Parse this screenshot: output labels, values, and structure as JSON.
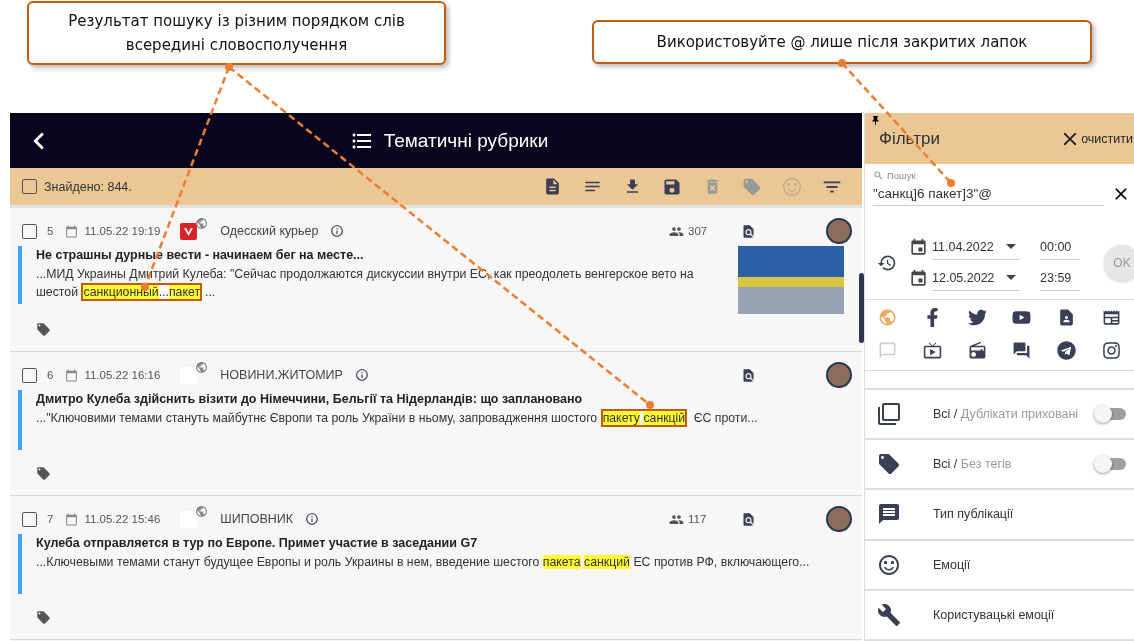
{
  "callouts": [
    {
      "text": "Результат пошуку із різним порядком слів всередині словосполучення"
    },
    {
      "text": "Використовуйте  @ лише після закритих лапок"
    }
  ],
  "header": {
    "title": "Тематичні рубрики"
  },
  "toolbar": {
    "checked": false,
    "found": "Знайдено: 844."
  },
  "items": [
    {
      "checked": false,
      "number": "5",
      "date": "11.05.22 19:19",
      "brand_logo": true,
      "source": "Одесский курьер",
      "audience": "307",
      "thumbnail": true,
      "title": "Не страшны дурные вести - начинаем бег на месте...",
      "snippet": [
        {
          "kind": "text",
          "text": "...МИД Украины Дмитрий Кулеба: \"Сейчас продолжаются дискуссии внутри ЕС, как преодолеть венгерское вето на шестой "
        },
        {
          "kind": "frame",
          "parts": [
            {
              "kind": "text",
              "text": "санкционный",
              "highlight": true
            },
            {
              "kind": "text",
              "text": "...",
              "highlight": false
            },
            {
              "kind": "text",
              "text": "пакет",
              "highlight": true
            }
          ]
        },
        {
          "kind": "text",
          "text": "..."
        }
      ]
    },
    {
      "checked": false,
      "number": "6",
      "date": "11.05.22 16:16",
      "brand_logo": false,
      "source": "НОВИНИ.ЖИТОМИР",
      "thumbnail": false,
      "title": "Дмитро Кулеба здійснить візити до Німеччини, Бельгії та Нідерландів: що заплановано",
      "snippet": [
        {
          "kind": "text",
          "text": "...\"Ключовими темами стануть майбутнє Європи та роль України в ньому, запровадження шостого "
        },
        {
          "kind": "frame",
          "parts": [
            {
              "kind": "text",
              "text": "пакету",
              "highlight": true
            },
            {
              "kind": "gap"
            },
            {
              "kind": "text",
              "text": "санкцій",
              "highlight": true
            }
          ]
        },
        {
          "kind": "text",
          "text": " ЄС проти..."
        }
      ]
    },
    {
      "checked": false,
      "number": "7",
      "date": "11.05.22 15:46",
      "brand_logo": false,
      "source": "ШИПОВНИК",
      "audience": "117",
      "thumbnail": false,
      "title": "Кулеба отправляется в тур по Европе. Примет участие в заседании G7",
      "snippet": [
        {
          "kind": "text",
          "text": "...Ключевыми темами станут будущее Европы и роль Украины в нем, введение шестого "
        },
        {
          "kind": "text",
          "text": "пакета",
          "highlight": true
        },
        {
          "kind": "gap"
        },
        {
          "kind": "text",
          "text": "санкций",
          "highlight": true
        },
        {
          "kind": "text",
          "text": " ЕС против РФ, включающего...",
          "highlight": false
        }
      ]
    }
  ],
  "filters": {
    "title": "Фільтри",
    "clear": "очистити",
    "search_label": "Пошук",
    "search_value": "\"санкц]6 пакет]3\"@",
    "dates": [
      {
        "date": "11.04.2022",
        "time": "00:00"
      },
      {
        "date": "12.05.2022",
        "time": "23:59"
      }
    ],
    "ok": "OK",
    "sources": [
      {
        "kind": "web",
        "selected": true
      },
      {
        "kind": "facebook",
        "selected": false
      },
      {
        "kind": "twitter",
        "selected": false
      },
      {
        "kind": "youtube",
        "selected": false
      },
      {
        "kind": "contact",
        "selected": false
      },
      {
        "kind": "news",
        "selected": false
      },
      {
        "kind": "comment",
        "selected": false,
        "disabled": true
      },
      {
        "kind": "tv",
        "selected": false
      },
      {
        "kind": "radio",
        "selected": false
      },
      {
        "kind": "forum",
        "selected": false
      },
      {
        "kind": "telegram",
        "selected": false
      },
      {
        "kind": "instagram",
        "selected": false
      }
    ],
    "rows": [
      {
        "kind": "duplicates",
        "all": "Всі /",
        "option": "Дублікати приховані",
        "on": false
      },
      {
        "kind": "tags",
        "all": "Всі /",
        "option": "Без тегів",
        "on": false
      },
      {
        "kind": "types",
        "label": "Тип публікації"
      },
      {
        "kind": "emotions",
        "label": "Емоції"
      },
      {
        "kind": "custom",
        "label": "Користувацькі емоції"
      }
    ]
  }
}
